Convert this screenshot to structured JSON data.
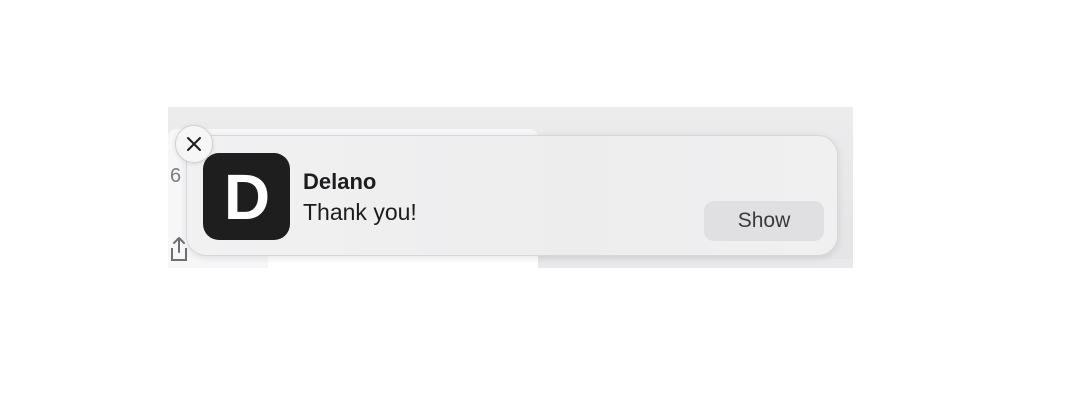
{
  "background": {
    "partial_text": "6"
  },
  "notification": {
    "app_name": "Delano",
    "app_icon_letter": "D",
    "message": "Thank you!",
    "show_label": "Show",
    "close_icon": "close-icon",
    "icon_background": "#1e1e1e"
  }
}
